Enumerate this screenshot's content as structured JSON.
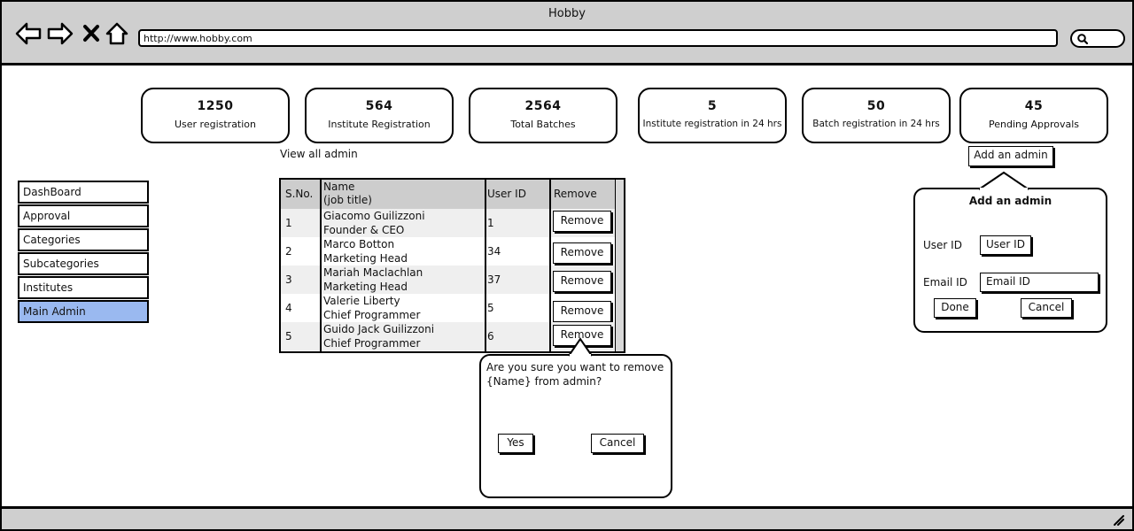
{
  "window": {
    "title": "Hobby"
  },
  "browser": {
    "url": "http://www.hobby.com"
  },
  "stats": [
    {
      "value": "1250",
      "label": "User registration"
    },
    {
      "value": "564",
      "label": "Institute Registration"
    },
    {
      "value": "2564",
      "label": "Total Batches"
    },
    {
      "value": "5",
      "label": "Institute registration in 24 hrs"
    },
    {
      "value": "50",
      "label": "Batch registration in 24 hrs"
    },
    {
      "value": "45",
      "label": "Pending Approvals"
    }
  ],
  "sidebar": {
    "items": [
      {
        "label": "DashBoard"
      },
      {
        "label": "Approval"
      },
      {
        "label": "Categories"
      },
      {
        "label": "Subcategories"
      },
      {
        "label": "Institutes"
      },
      {
        "label": "Main Admin",
        "active": true
      }
    ],
    "active_color": "#9ab9f0"
  },
  "main": {
    "view_all_link": "View all admin",
    "table": {
      "headers": {
        "sno": "S.No.",
        "name": "Name",
        "name_sub": "(job title)",
        "user_id": "User ID",
        "remove": "Remove"
      },
      "rows": [
        {
          "sno": "1",
          "name": "Giacomo Guilizzoni",
          "title": "Founder & CEO",
          "user_id": "1",
          "action": "Remove"
        },
        {
          "sno": "2",
          "name": "Marco Botton",
          "title": "Marketing Head",
          "user_id": "34",
          "action": "Remove"
        },
        {
          "sno": "3",
          "name": "Mariah Maclachlan",
          "title": "Marketing Head",
          "user_id": "37",
          "action": "Remove"
        },
        {
          "sno": "4",
          "name": "Valerie Liberty",
          "title": "Chief Programmer",
          "user_id": "5",
          "action": "Remove"
        },
        {
          "sno": "5",
          "name": "Guido Jack Guilizzoni",
          "title": "Chief Programmer",
          "user_id": "6",
          "action": "Remove"
        }
      ]
    }
  },
  "confirm_dialog": {
    "message": "Are you sure you want to remove {Name} from admin?",
    "yes_label": "Yes",
    "cancel_label": "Cancel"
  },
  "add_admin": {
    "button_label": "Add an admin",
    "panel": {
      "title": "Add an admin",
      "user_id_label": "User ID",
      "user_id_placeholder": "User ID",
      "email_label": "Email ID",
      "email_placeholder": "Email ID",
      "done_label": "Done",
      "cancel_label": "Cancel"
    }
  },
  "icons": [
    "back-icon",
    "forward-icon",
    "stop-icon",
    "home-icon",
    "search-icon",
    "resize-grip-icon"
  ]
}
